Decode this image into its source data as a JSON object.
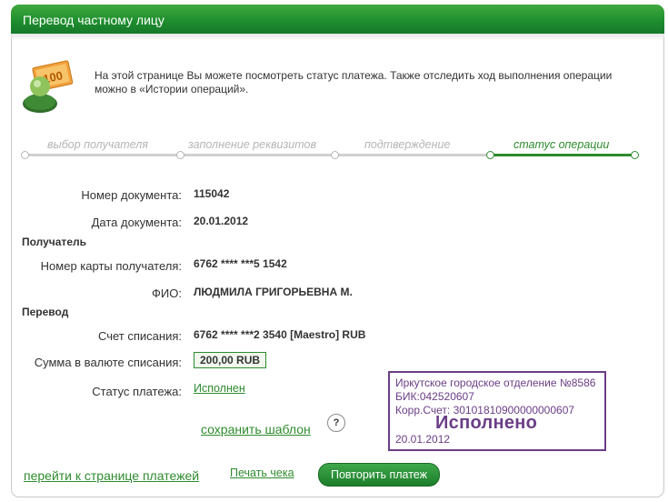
{
  "header": {
    "title": "Перевод частному лицу"
  },
  "info": {
    "line1": "На этой странице Вы можете посмотреть статус платежа. Также отследить ход выполнения операции",
    "line2": "можно в «Истории операций».",
    "icon_card_text": "100"
  },
  "steps": [
    {
      "label": "выбор получателя",
      "state": "done"
    },
    {
      "label": "заполнение реквизитов",
      "state": "done"
    },
    {
      "label": "подтверждение",
      "state": "done"
    },
    {
      "label": "статус операции",
      "state": "active"
    }
  ],
  "document": {
    "number_label": "Номер документа:",
    "number_value": "115042",
    "date_label": "Дата документа:",
    "date_value": "20.01.2012"
  },
  "recipient": {
    "section_title": "Получатель",
    "card_label": "Номер карты получателя:",
    "card_value": "6762 **** ***5 1542",
    "name_label": "ФИО:",
    "name_value": "ЛЮДМИЛА ГРИГОРЬЕВНА М."
  },
  "transfer": {
    "section_title": "Перевод",
    "account_label": "Счет списания:",
    "account_value": "6762 **** ***2 3540  [Maestro]  RUB",
    "amount_label": "Сумма в валюте списания:",
    "amount_value": "200,00  RUB",
    "status_label": "Статус платежа:",
    "status_value": "Исполнен"
  },
  "actions": {
    "save_template": "сохранить шаблон",
    "help": "?",
    "to_payments": "перейти к странице платежей",
    "print_receipt": "Печать чека",
    "repeat_payment": "Повторить платеж"
  },
  "stamp": {
    "line1": "Иркутское городское отделение №8586",
    "line2": "БИК:042520607",
    "line3": "Корр.Счет: 30101810900000000607",
    "big": "Исполнено",
    "date": "20.01.2012"
  },
  "colors": {
    "brand_green": "#2e8b2e",
    "stamp_purple": "#6b3e86",
    "inactive_grey": "#b5b5b5"
  }
}
